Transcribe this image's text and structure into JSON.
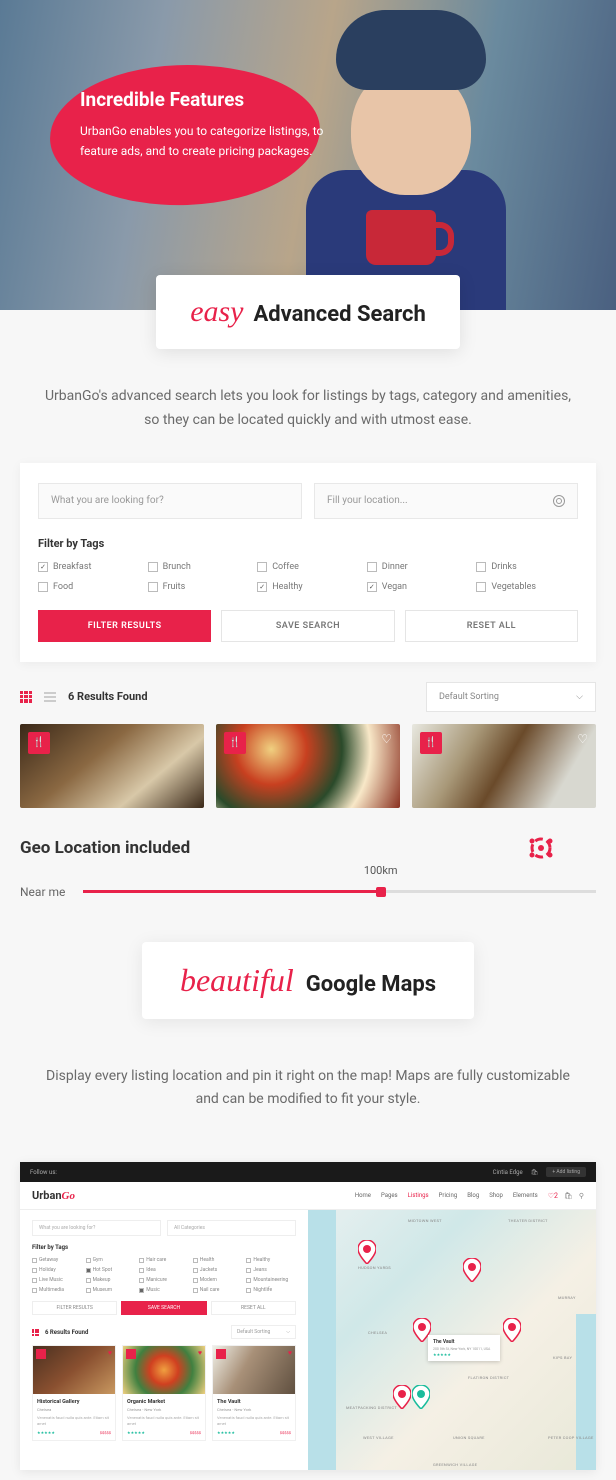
{
  "hero": {
    "title": "Incredible Features",
    "desc": "UrbanGo enables you to categorize listings, to feature ads, and to create pricing packages."
  },
  "search_section": {
    "script": "easy",
    "title": "Advanced Search",
    "intro": "UrbanGo's advanced search lets you look for listings by tags, category and amenities, so they can be located quickly and with utmost ease.",
    "input1_placeholder": "What you are looking for?",
    "input2_placeholder": "Fill your location...",
    "filter_label": "Filter by Tags",
    "tags": [
      {
        "label": "Breakfast",
        "checked": true
      },
      {
        "label": "Brunch",
        "checked": false
      },
      {
        "label": "Coffee",
        "checked": false
      },
      {
        "label": "Dinner",
        "checked": false
      },
      {
        "label": "Drinks",
        "checked": false
      },
      {
        "label": "Food",
        "checked": false
      },
      {
        "label": "Fruits",
        "checked": false
      },
      {
        "label": "Healthy",
        "checked": true
      },
      {
        "label": "Vegan",
        "checked": true
      },
      {
        "label": "Vegetables",
        "checked": false
      }
    ],
    "btn_filter": "FILTER RESULTS",
    "btn_save": "SAVE SEARCH",
    "btn_reset": "RESET ALL",
    "results_count": "6 Results Found",
    "sort": "Default Sorting"
  },
  "geo": {
    "title": "Geo Location included",
    "near": "Near me",
    "value": "100km"
  },
  "maps_section": {
    "script": "beautiful",
    "title": "Google Maps",
    "intro": "Display every listing location and pin it right on the map! Maps are fully customizable and can be modified to fit your style."
  },
  "demo": {
    "topbar_follow": "Follow us:",
    "topbar_user": "Cintia Edge",
    "topbar_add": "+ Add listing",
    "logo_a": "Urban",
    "logo_b": "Go",
    "nav": [
      "Home",
      "Pages",
      "Listings",
      "Pricing",
      "Blog",
      "Shop",
      "Elements"
    ],
    "nav_active_idx": 2,
    "heart_count": "2",
    "cart_count": "",
    "input1": "What you are looking for?",
    "input2": "All Categories",
    "filter_label": "Filter by Tags",
    "tags2": [
      {
        "l": "Getaway",
        "c": false
      },
      {
        "l": "Gym",
        "c": false
      },
      {
        "l": "Hair care",
        "c": false
      },
      {
        "l": "Health",
        "c": false
      },
      {
        "l": "Healthy",
        "c": false
      },
      {
        "l": "Holiday",
        "c": false
      },
      {
        "l": "Hot Spot",
        "c": true
      },
      {
        "l": "Idea",
        "c": false
      },
      {
        "l": "Jackets",
        "c": false
      },
      {
        "l": "Jeans",
        "c": false
      },
      {
        "l": "Live Music",
        "c": false
      },
      {
        "l": "Makeup",
        "c": false
      },
      {
        "l": "Manicure",
        "c": false
      },
      {
        "l": "Modern",
        "c": false
      },
      {
        "l": "Mountaineering",
        "c": false
      },
      {
        "l": "Multimedia",
        "c": false
      },
      {
        "l": "Museum",
        "c": false
      },
      {
        "l": "Music",
        "c": true
      },
      {
        "l": "Nail care",
        "c": false
      },
      {
        "l": "Nightlife",
        "c": false
      }
    ],
    "btn_filter": "FILTER RESULTS",
    "btn_save": "SAVE SEARCH",
    "btn_reset": "RESET ALL",
    "results_count": "6 Results Found",
    "sort": "Default Sorting",
    "cards": [
      {
        "title": "Historical Gallery",
        "sub": "Chelsea",
        "desc": "Venenatis faucl nulla quis ante. Etiam sit amet",
        "stars": "★★★★★",
        "price": "$$$$$"
      },
      {
        "title": "Organic Market",
        "sub": "Chelsea - New York",
        "desc": "Venenatis faucl nulla quis ante. Etiam sit amet",
        "stars": "★★★★★",
        "price": "$$$$$"
      },
      {
        "title": "The Vault",
        "sub": "Chelsea - New York",
        "desc": "Venenatis faucl nulla quis ante. Etiam sit amet",
        "stars": "★★★★★",
        "price": "$$$$$"
      }
    ],
    "popup": {
      "title": "The Vault",
      "addr": "200 5th St, New York, NY 10011, USA",
      "stars": "★★★★★"
    },
    "map_labels": [
      "MIDTOWN WEST",
      "THEATER DISTRICT",
      "HUDSON YARDS",
      "MURRAY",
      "CHELSEA",
      "KIPS BAY",
      "FLATIRON DISTRICT",
      "MEATPACKING DISTRICT",
      "WEST VILLAGE",
      "UNION SQUARE",
      "PETER COOP VILLAGE",
      "GREENWICH VILLAGE"
    ]
  }
}
